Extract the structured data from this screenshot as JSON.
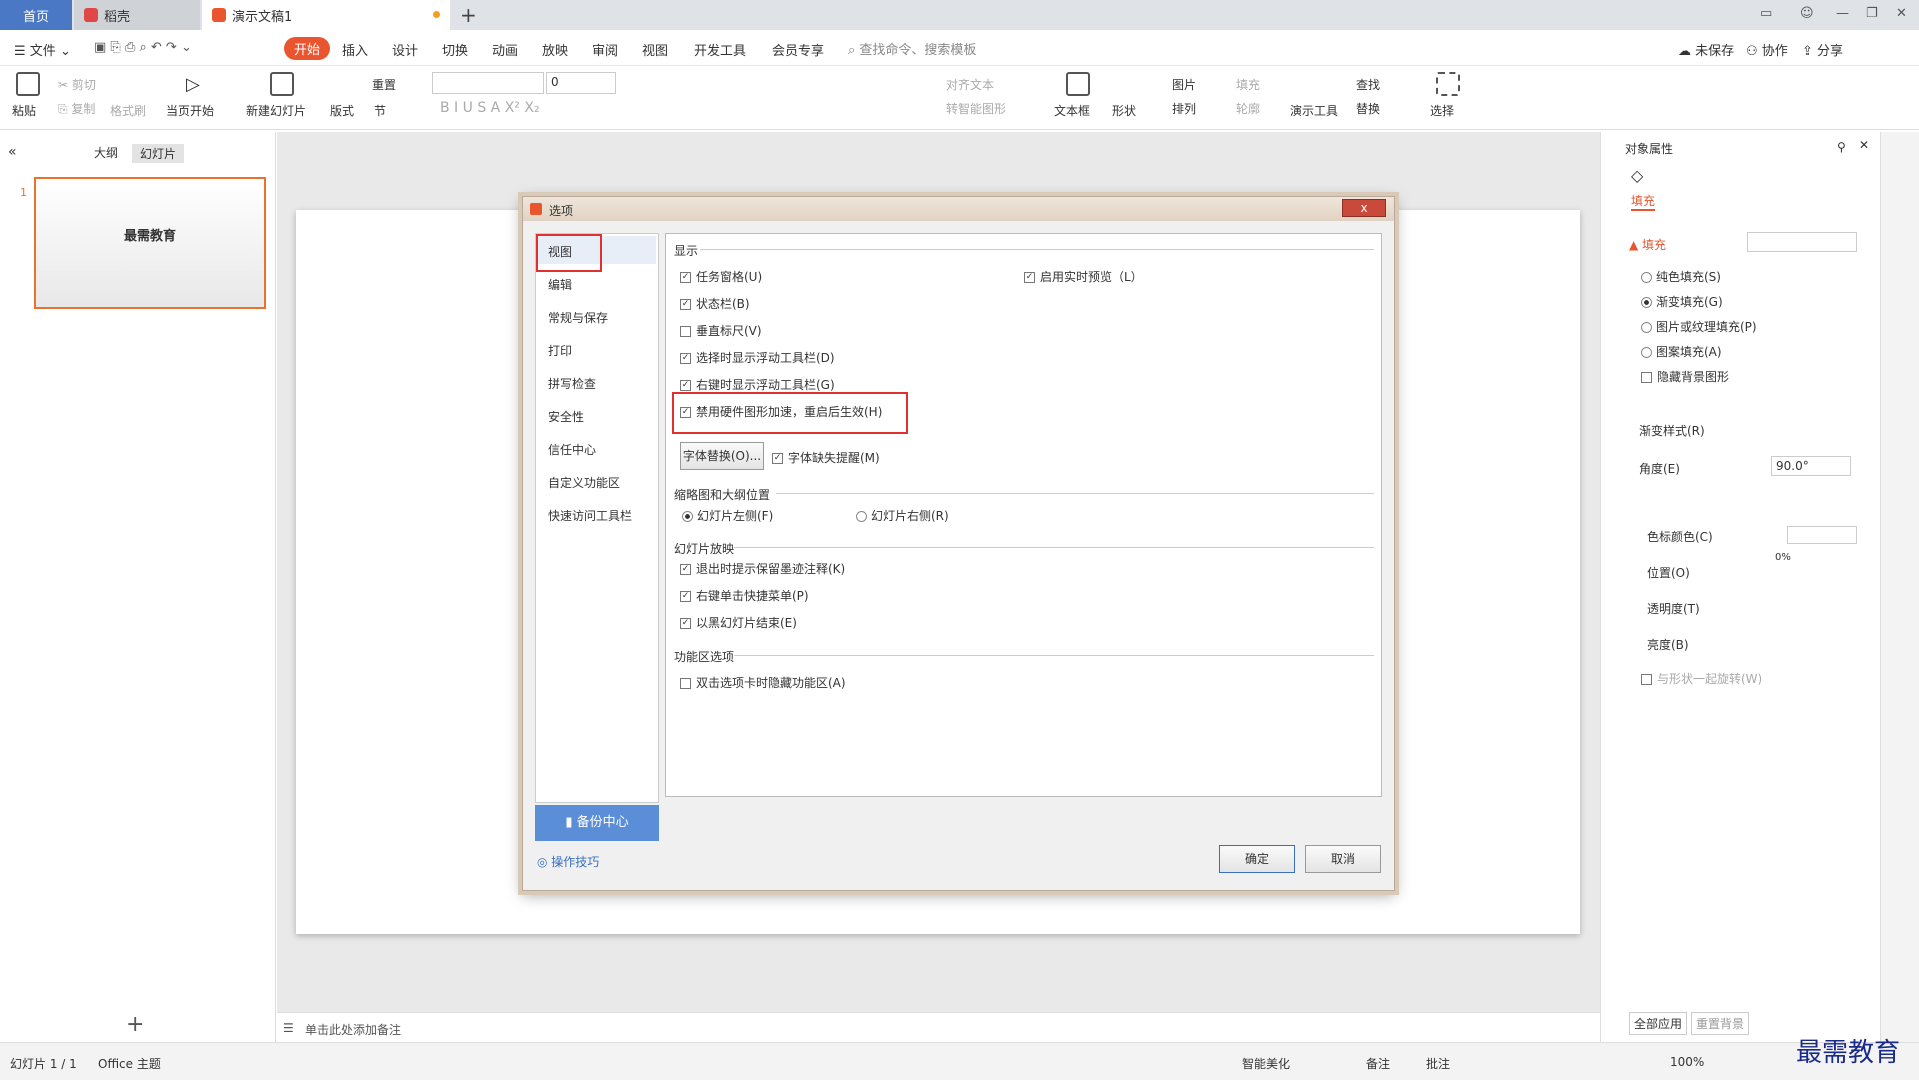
{
  "tabs": {
    "home": "首页",
    "t2": "稻壳",
    "t3": "演示文稿1"
  },
  "menu": {
    "file": "文件",
    "start": "开始",
    "insert": "插入",
    "design": "设计",
    "transition": "切换",
    "animation": "动画",
    "show": "放映",
    "review": "审阅",
    "view": "视图",
    "dev": "开发工具",
    "member": "会员专享",
    "search": "查找命令、搜索模板",
    "unsaved": "未保存",
    "collab": "协作",
    "share": "分享"
  },
  "toolbar": {
    "paste": "粘贴",
    "cut": "剪切",
    "copy": "复制",
    "format": "格式刷",
    "fromcurrent": "当页开始",
    "newslide": "新建幻灯片",
    "layout": "版式",
    "section": "节",
    "reset": "重置",
    "fontsize": "0",
    "align": "对齐文本",
    "smart": "转智能图形",
    "textbox": "文本框",
    "shape": "形状",
    "picture": "图片",
    "arrange": "排列",
    "fill": "填充",
    "outline": "轮廓",
    "tools": "演示工具",
    "find": "查找",
    "replace": "替换",
    "select": "选择"
  },
  "leftpane": {
    "outline": "大纲",
    "slides": "幻灯片",
    "num": "1",
    "thumb_title": "最需教育"
  },
  "notes": "单击此处添加备注",
  "dialog": {
    "title": "选项",
    "close": "x",
    "nav": [
      "视图",
      "编辑",
      "常规与保存",
      "打印",
      "拼写检查",
      "安全性",
      "信任中心",
      "自定义功能区",
      "快速访问工具栏"
    ],
    "sec_display": "显示",
    "opts1": [
      "任务窗格(U)",
      "状态栏(B)",
      "垂直标尺(V)",
      "选择时显示浮动工具栏(D)",
      "右键时显示浮动工具栏(G)",
      "禁用硬件图形加速，重启后生效(H)"
    ],
    "realtime": "启用实时预览（L）",
    "fontrep": "字体替换(O)...",
    "fontmissing": "字体缺失提醒(M)",
    "sec_pos": "缩略图和大纲位置",
    "left": "幻灯片左侧(F)",
    "right": "幻灯片右侧(R)",
    "sec_show": "幻灯片放映",
    "opts2": [
      "退出时提示保留墨迹注释(K)",
      "右键单击快捷菜单(P)",
      "以黑幻灯片结束(E)"
    ],
    "sec_ribbon": "功能区选项",
    "ribbonopt": "双击选项卡时隐藏功能区(A)",
    "backup": "备份中心",
    "tips": "操作技巧",
    "ok": "确定",
    "cancel": "取消"
  },
  "rightpane": {
    "title": "对象属性",
    "filltab": "填充",
    "fill": "填充",
    "solid": "纯色填充(S)",
    "gradient": "渐变填充(G)",
    "picture": "图片或纹理填充(P)",
    "pattern": "图案填充(A)",
    "hidebg": "隐藏背景图形",
    "gstyle": "渐变样式(R)",
    "angle": "角度(E)",
    "angleval": "90.0°",
    "stopcolor": "色标颜色(C)",
    "position": "位置(O)",
    "transp": "透明度(T)",
    "bright": "亮度(B)",
    "pct0": "0%",
    "rotate": "与形状一起旋转(W)",
    "applyall": "全部应用",
    "resetbg": "重置背景"
  },
  "status": {
    "slide": "幻灯片 1 / 1",
    "theme": "Office 主题",
    "beautify": "智能美化",
    "notes": "备注",
    "comment": "批注",
    "zoom": "100%"
  },
  "watermark": "最需教育"
}
